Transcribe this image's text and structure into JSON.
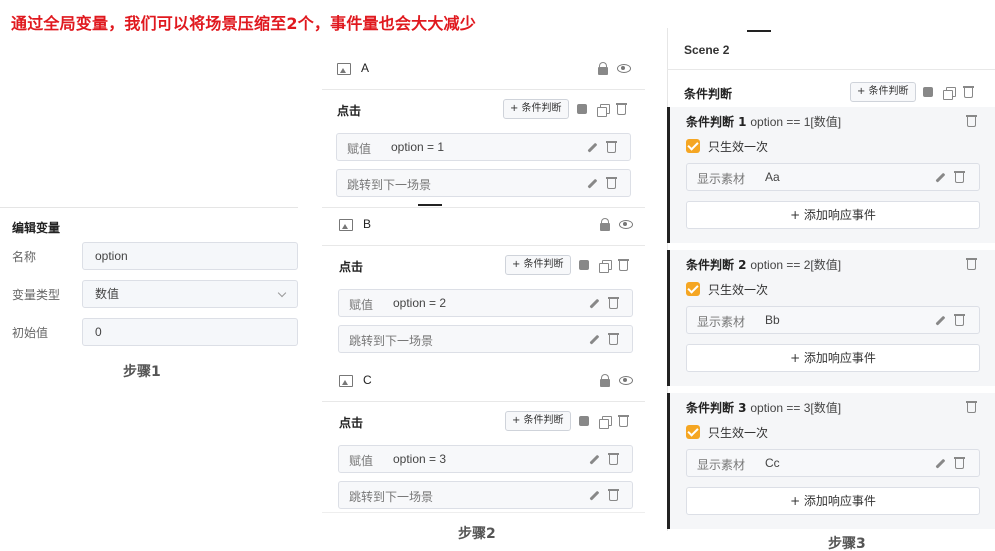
{
  "headline": "通过全局变量，我们可以将场景压缩至2个，事件量也会大大减少",
  "step1": {
    "title": "编辑变量",
    "fields": [
      {
        "label": "名称",
        "value": "option"
      },
      {
        "label": "变量类型",
        "value": "数值"
      },
      {
        "label": "初始值",
        "value": "0"
      }
    ],
    "step_label": "步骤1"
  },
  "step2": {
    "scenes": [
      {
        "name": "A",
        "event": "点击",
        "cond_button": "+ 条件判断",
        "assign_label": "赋值",
        "assign_value": "option = 1",
        "jump_label": "跳转到下一场景"
      },
      {
        "name": "B",
        "event": "点击",
        "cond_button": "+ 条件判断",
        "assign_label": "赋值",
        "assign_value": "option = 2",
        "jump_label": "跳转到下一场景"
      },
      {
        "name": "C",
        "event": "点击",
        "cond_button": "+ 条件判断",
        "assign_label": "赋值",
        "assign_value": "option = 3",
        "jump_label": "跳转到下一场景"
      }
    ],
    "step_label": "步骤2"
  },
  "step3": {
    "scene_title": "Scene 2",
    "section_title": "条件判断",
    "cond_button": "+ 条件判断",
    "conditions": [
      {
        "title": "条件判断 1",
        "expr": "option == 1[数值]",
        "once_label": "只生效一次",
        "material_label": "显示素材",
        "material_value": "Aa",
        "add_label": "+ 添加响应事件"
      },
      {
        "title": "条件判断 2",
        "expr": "option == 2[数值]",
        "once_label": "只生效一次",
        "material_label": "显示素材",
        "material_value": "Bb",
        "add_label": "+ 添加响应事件"
      },
      {
        "title": "条件判断 3",
        "expr": "option == 3[数值]",
        "once_label": "只生效一次",
        "material_label": "显示素材",
        "material_value": "Cc",
        "add_label": "+ 添加响应事件"
      }
    ],
    "step_label": "步骤3"
  },
  "colors": {
    "headline": "#e0191f",
    "checkbox": "#f5a623"
  },
  "icons": [
    "image-icon",
    "lock-icon",
    "eye-icon",
    "edit-icon",
    "copy-icon",
    "trash-icon",
    "pencil-icon",
    "chevron-down-icon",
    "checkbox-checked-icon"
  ]
}
